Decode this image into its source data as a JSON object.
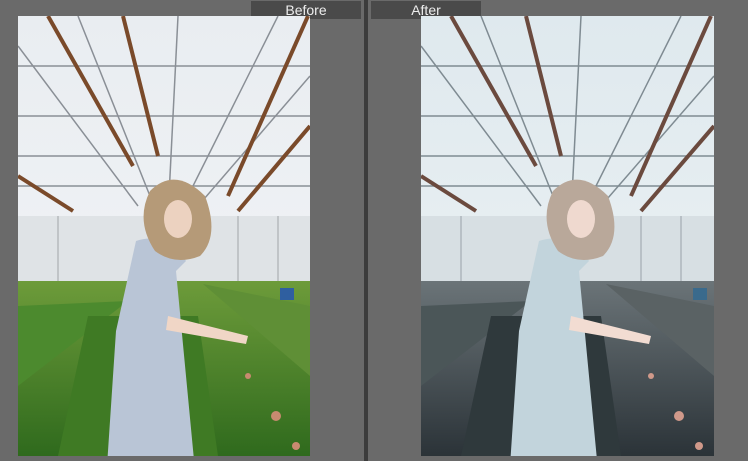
{
  "comparison": {
    "before_label": "Before",
    "after_label": "After"
  },
  "colors": {
    "background": "#6a6a6a",
    "label_bg": "#4a4a4a",
    "before_plants": "#4f8a2c",
    "after_plants": "#3e4a4a",
    "dress": "#b8c6d8"
  }
}
